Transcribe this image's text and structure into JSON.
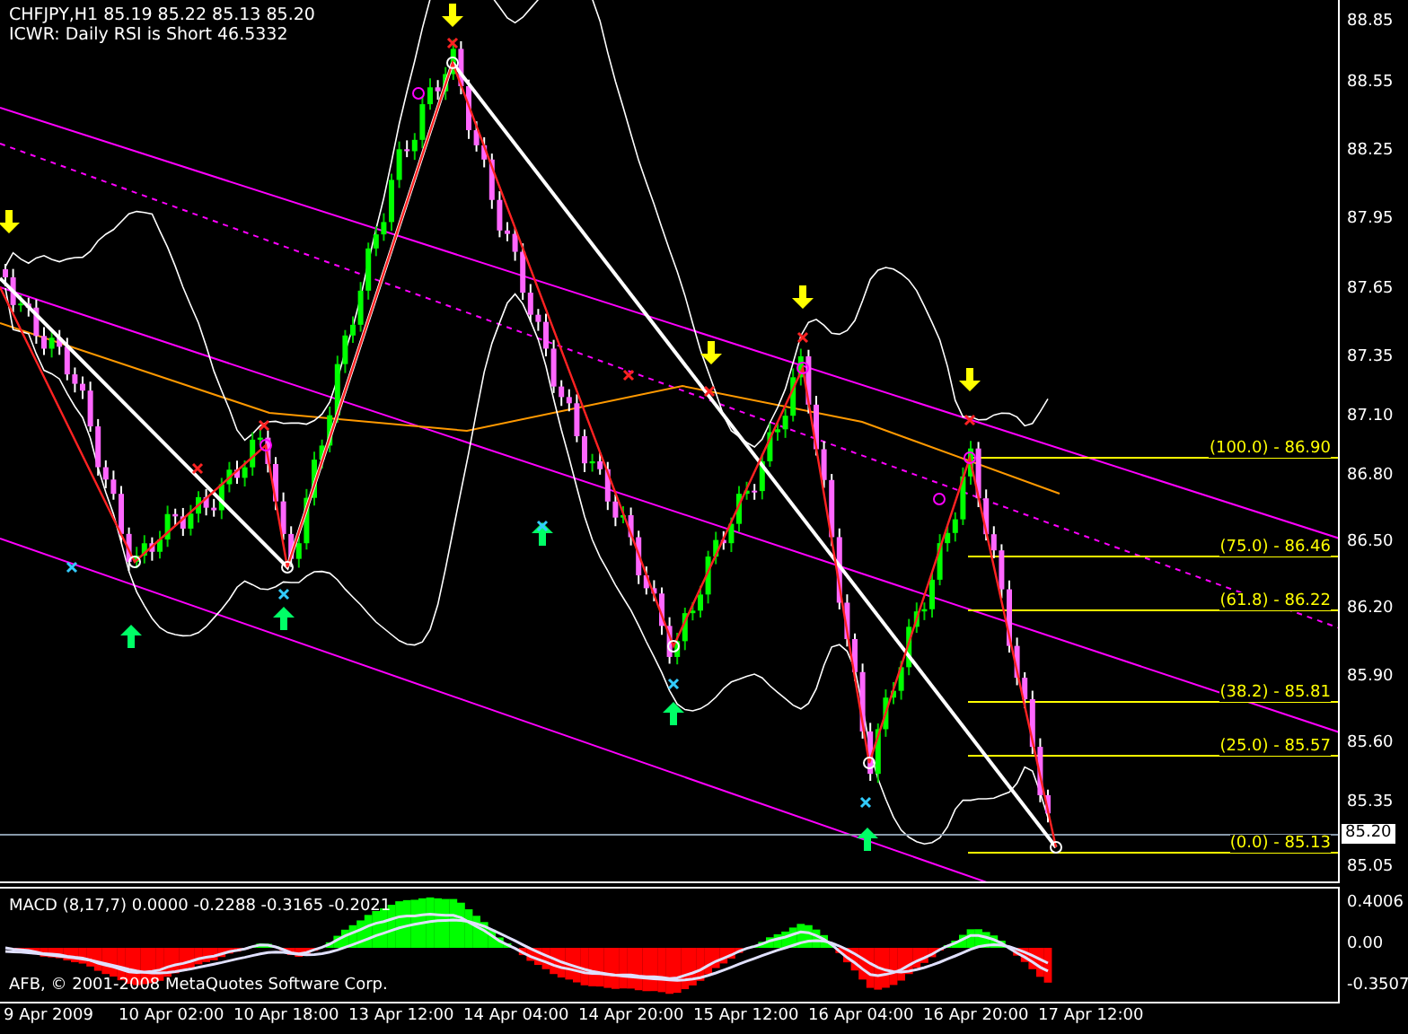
{
  "chart_header": {
    "symbol_line": "CHFJPY,H1  85.19 85.22 85.13 85.20",
    "signal_line": "ICWR: Daily RSI is Short 46.5332"
  },
  "price_axis": [
    "88.85",
    "88.55",
    "88.25",
    "87.95",
    "87.65",
    "87.35",
    "87.10",
    "86.80",
    "86.50",
    "86.20",
    "85.90",
    "85.60",
    "85.35",
    "85.05"
  ],
  "current_price": "85.20",
  "fibonacci_levels": [
    "(100.0) - 86.90",
    "(75.0) - 86.46",
    "(61.8) - 86.22",
    "(38.2) - 85.81",
    "(25.0) - 85.57",
    "(0.0) - 85.13"
  ],
  "macd": {
    "title": "MACD  (8,17,7) 0.0000 -0.2288 -0.3165 -0.2021",
    "copyright": "AFB, © 2001-2008 MetaQuotes Software Corp.",
    "axis": [
      "0.4006",
      "0.00",
      "-0.3507"
    ]
  },
  "time_axis": [
    "9 Apr 2009",
    "10 Apr 02:00",
    "10 Apr 18:00",
    "13 Apr 12:00",
    "14 Apr 04:00",
    "14 Apr 20:00",
    "15 Apr 12:00",
    "16 Apr 04:00",
    "16 Apr 20:00",
    "17 Apr 12:00"
  ]
}
